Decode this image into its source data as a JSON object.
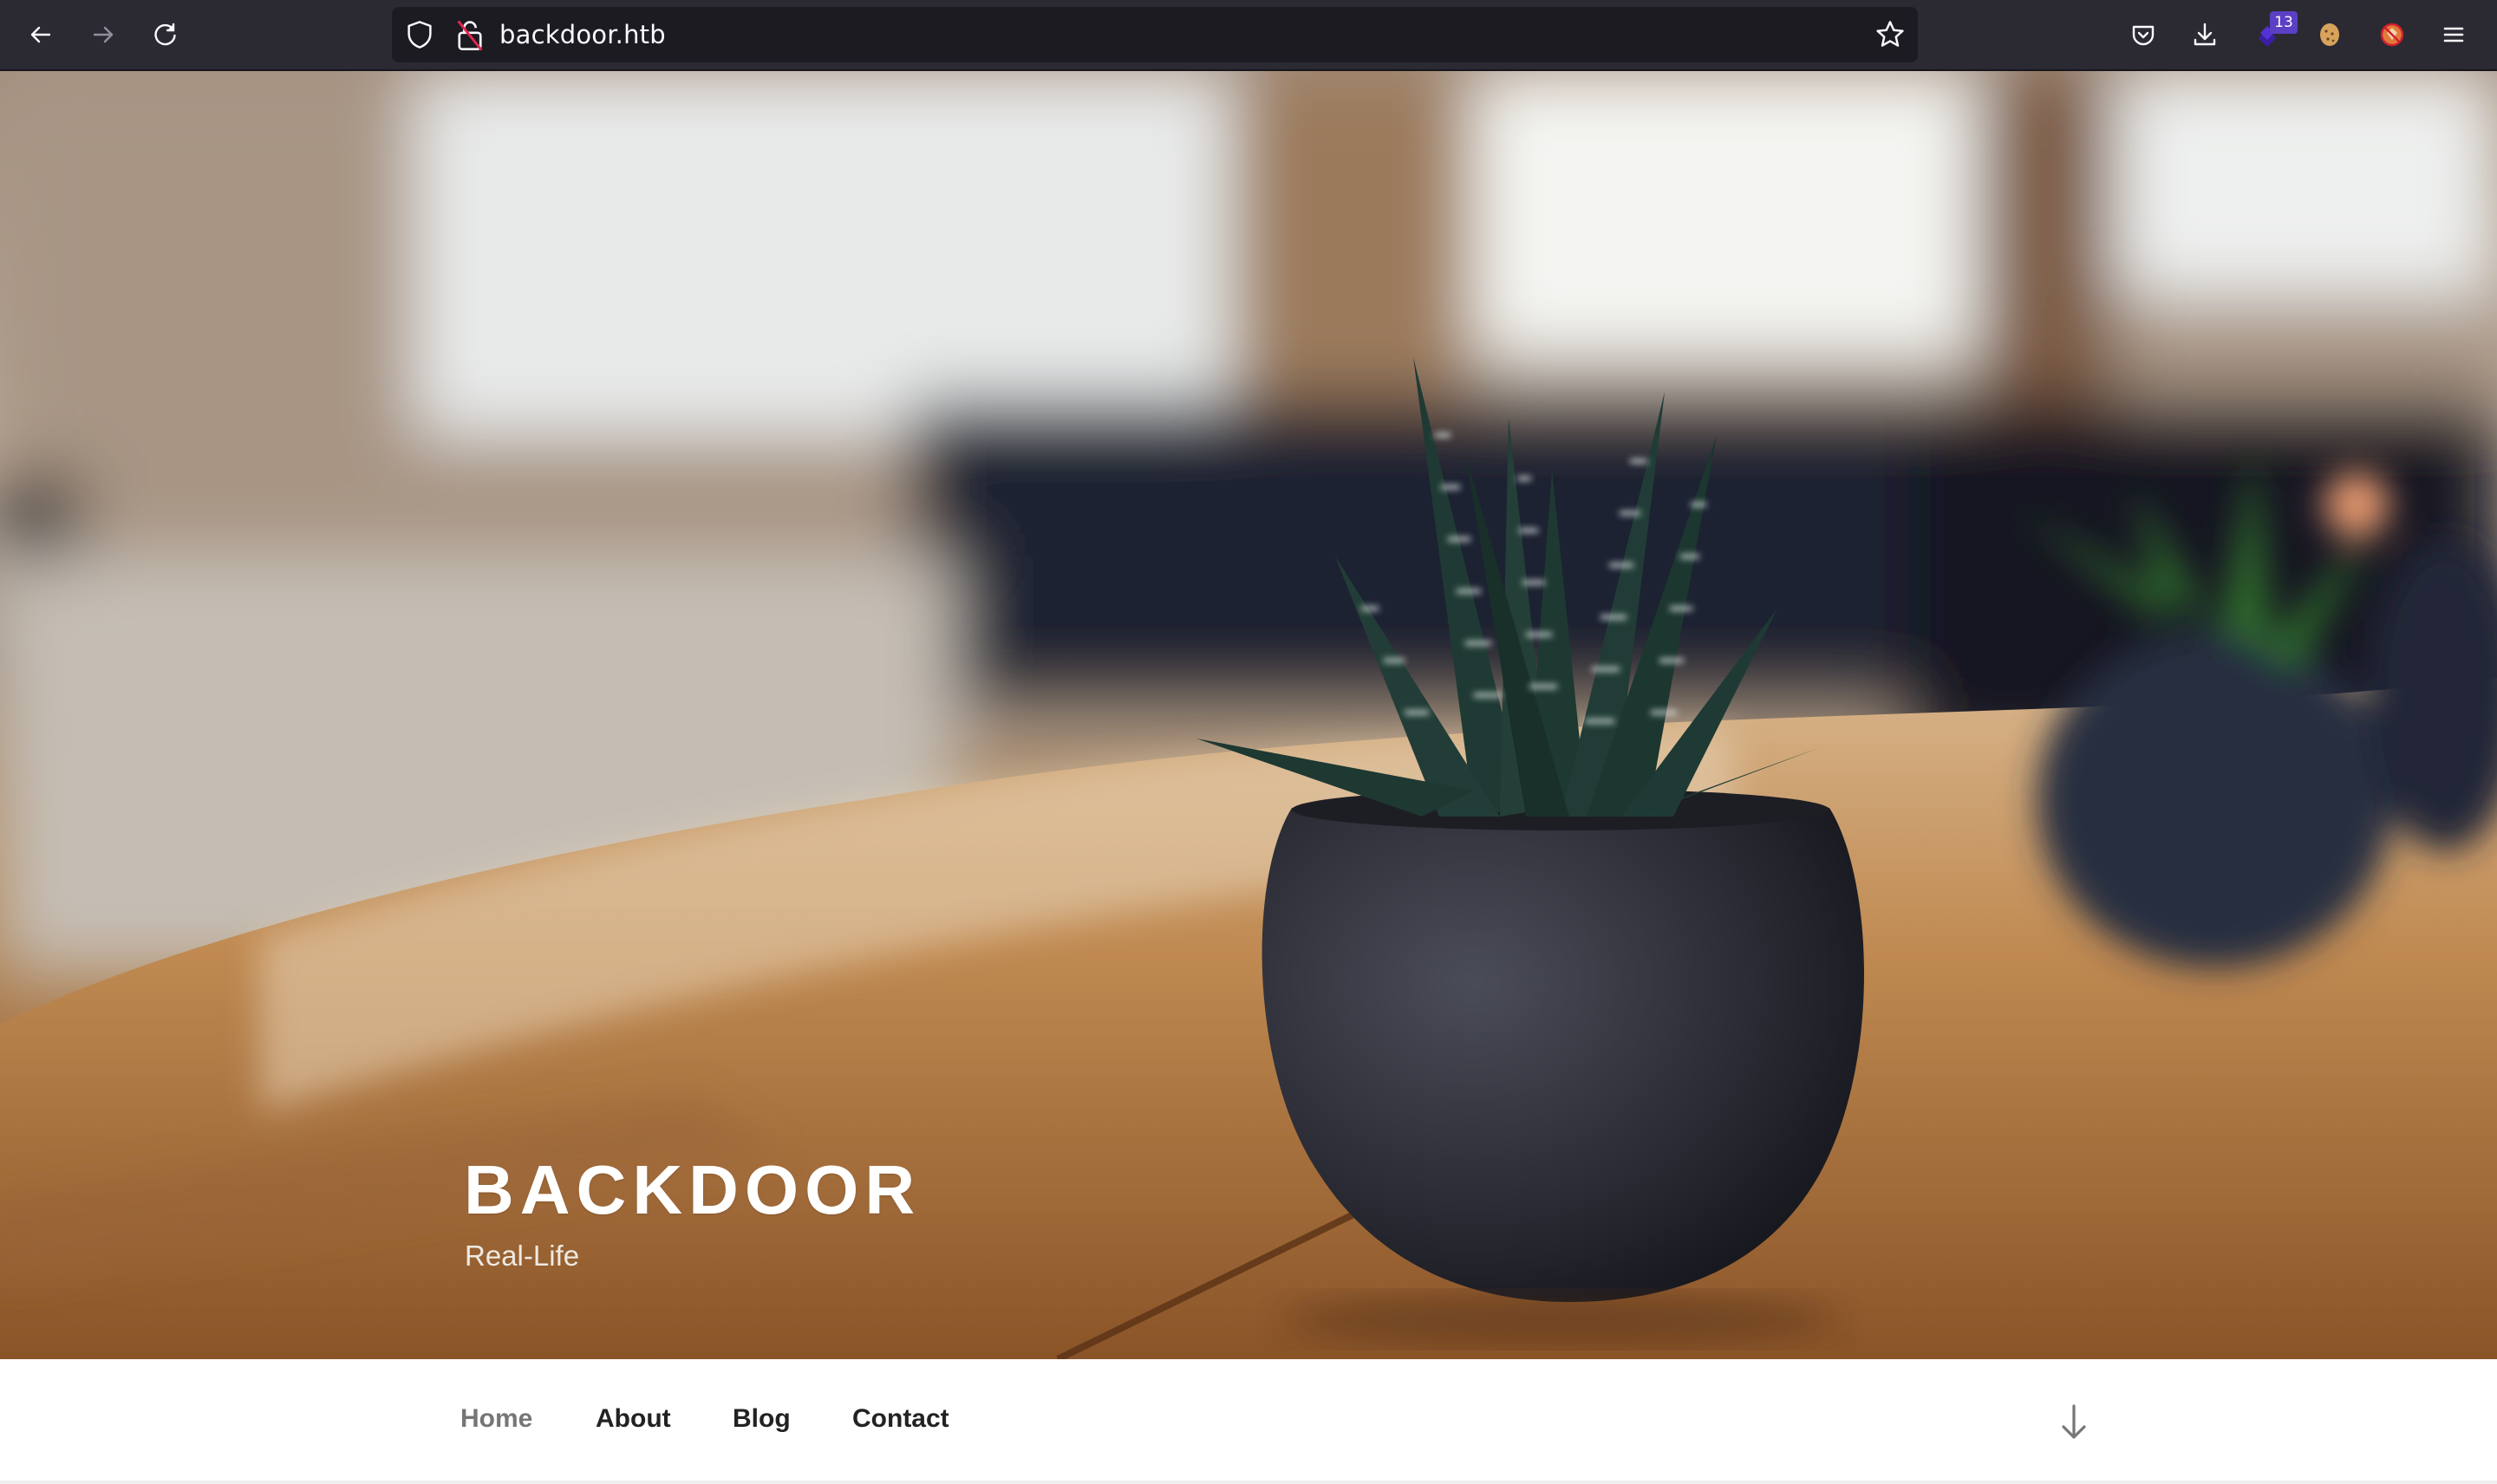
{
  "browser": {
    "url": "backdoor.htb",
    "extension_badge_count": "13",
    "icons": {
      "back": "back-arrow-icon",
      "forward": "forward-arrow-icon",
      "reload": "reload-icon",
      "tracking_protection": "shield-icon",
      "insecure_connection": "insecure-lock-icon",
      "bookmark": "star-icon",
      "pocket": "pocket-icon",
      "downloads": "download-icon",
      "extension": "extension-icon",
      "cookie_extension": "cookie-icon",
      "blocked_extension": "blocked-extension-icon",
      "menu": "hamburger-menu-icon"
    }
  },
  "site": {
    "title": "BACKDOOR",
    "tagline": "Real-Life",
    "hero_image": "potted zebra succulent on wooden table"
  },
  "nav": {
    "items": [
      {
        "label": "Home",
        "active": true
      },
      {
        "label": "About",
        "active": false
      },
      {
        "label": "Blog",
        "active": false
      },
      {
        "label": "Contact",
        "active": false
      }
    ],
    "scroll_icon": "arrow-down-icon"
  },
  "colors": {
    "toolbar_bg": "#2b2a33",
    "urlbar_bg": "#1c1b22",
    "nav_text": "#222222",
    "nav_active": "#767676",
    "badge": "#5b3fc4"
  }
}
